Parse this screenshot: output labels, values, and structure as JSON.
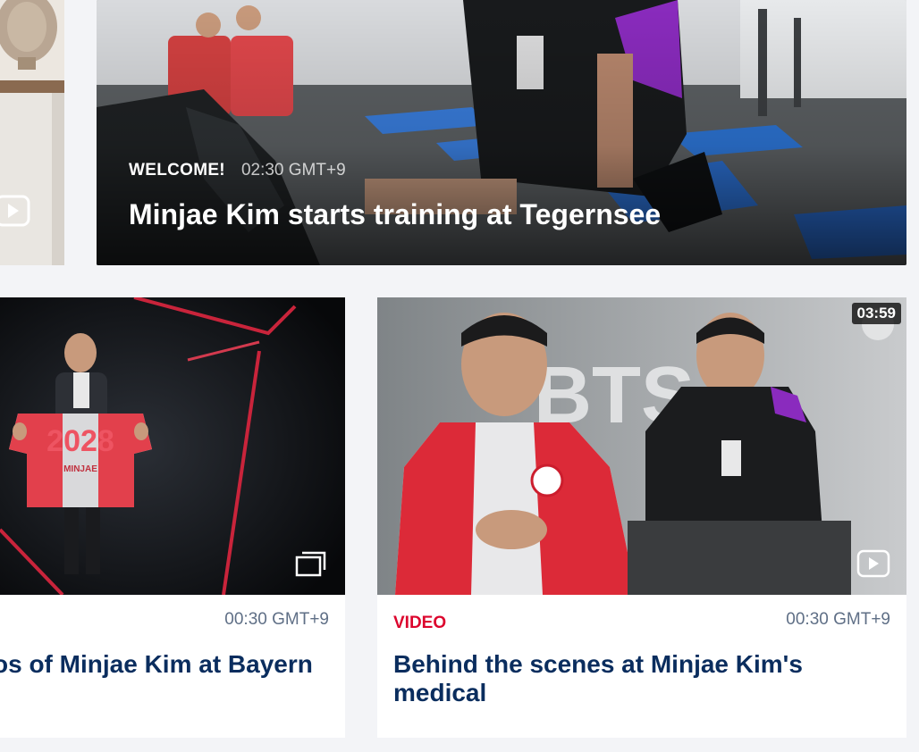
{
  "cards": {
    "hero": {
      "category": "WELCOME!",
      "time": "02:30 GMT+9",
      "title": "Minjae Kim starts training at Tegernsee"
    },
    "gallery": {
      "time": "00:30 GMT+9",
      "title": "os of Minjae Kim at Bayern",
      "jersey_text": "2028",
      "jersey_name": "MINJAE",
      "icon": "gallery-icon"
    },
    "video": {
      "category": "VIDEO",
      "time": "00:30 GMT+9",
      "title": "Behind the scenes at Minjae Kim's medical",
      "duration": "03:59",
      "bg_text": "BTS",
      "icon": "play-icon"
    },
    "topleft": {
      "icon": "play-icon"
    }
  },
  "colors": {
    "accent_red": "#dc052d",
    "title_navy": "#0a2d5e",
    "meta_gray": "#5f6f86",
    "page_bg": "#f3f4f7"
  }
}
